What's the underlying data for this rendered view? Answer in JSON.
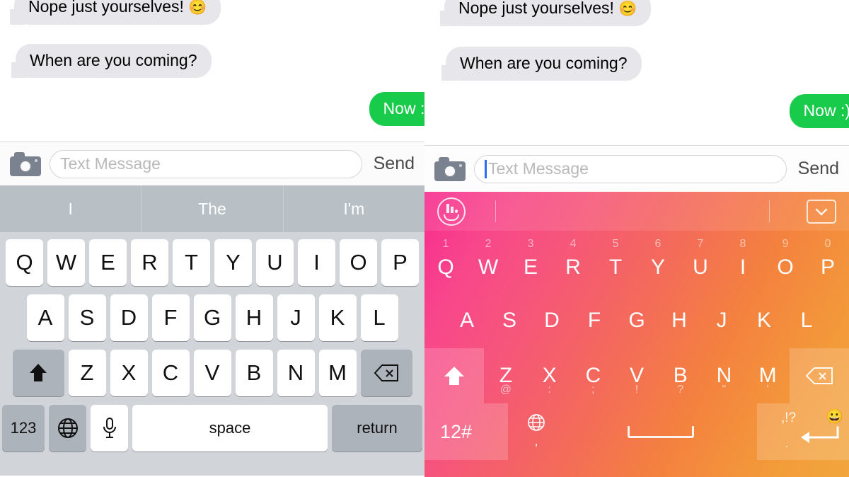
{
  "conversation": {
    "messages": [
      {
        "id": "msg-1",
        "text": "Nope just yourselves!",
        "emoji": "😊",
        "direction": "incoming",
        "bubble_color": "#e6e6eb"
      },
      {
        "id": "msg-2",
        "text": "When are you coming?",
        "emoji": "",
        "direction": "incoming",
        "bubble_color": "#e6e6eb"
      },
      {
        "id": "msg-3",
        "text": "Now :)",
        "emoji": "",
        "direction": "outgoing",
        "bubble_color": "#18cb4b"
      }
    ]
  },
  "input_bar": {
    "camera_icon": "camera-icon",
    "placeholder": "Text Message",
    "value": "",
    "send_label": "Send",
    "caret_color": "#2a6df4"
  },
  "left_keyboard": {
    "name": "ios-default-keyboard",
    "suggestions": [
      "I",
      "The",
      "I'm"
    ],
    "rows": {
      "row1": [
        "Q",
        "W",
        "E",
        "R",
        "T",
        "Y",
        "U",
        "I",
        "O",
        "P"
      ],
      "row2": [
        "A",
        "S",
        "D",
        "F",
        "G",
        "H",
        "J",
        "K",
        "L"
      ],
      "row3": [
        "Z",
        "X",
        "C",
        "V",
        "B",
        "N",
        "M"
      ]
    },
    "shift_icon": "shift-icon",
    "backspace_icon": "backspace-icon",
    "numeric_label": "123",
    "globe_icon": "globe-icon",
    "mic_icon": "microphone-icon",
    "space_label": "space",
    "return_label": "return",
    "colors": {
      "background": "#d1d4d9",
      "suggestion_bar": "#b8bfc5",
      "key": "#ffffff",
      "special_key": "#adb3bb"
    }
  },
  "right_keyboard": {
    "name": "touchpal-gradient-keyboard",
    "logo_icon": "touchpal-logo-icon",
    "collapse_icon": "chevron-down-icon",
    "numbers_row": [
      "1",
      "2",
      "3",
      "4",
      "5",
      "6",
      "7",
      "8",
      "9",
      "0"
    ],
    "rows": {
      "row1": [
        "Q",
        "W",
        "E",
        "R",
        "T",
        "Y",
        "U",
        "I",
        "O",
        "P"
      ],
      "row2": [
        "A",
        "S",
        "D",
        "F",
        "G",
        "H",
        "J",
        "K",
        "L"
      ],
      "row3": [
        "Z",
        "X",
        "C",
        "V",
        "B",
        "N",
        "M"
      ]
    },
    "row3_subs": [
      "@",
      ":",
      ";",
      "!",
      "?",
      "\"",
      "'"
    ],
    "shift_icon": "shift-icon",
    "backspace_icon": "backspace-icon",
    "numeric_label": "12#",
    "globe_icon": "globe-icon",
    "comma_label": ",",
    "space_icon": "spacebar-icon",
    "punctuation_label": ",!?",
    "period_label": ".",
    "emoji_icon": "😀",
    "enter_icon": "enter-arrow-icon",
    "colors": {
      "gradient_start": "#f82b8f",
      "gradient_mid": "#f4675f",
      "gradient_end": "#f2a63c"
    }
  }
}
